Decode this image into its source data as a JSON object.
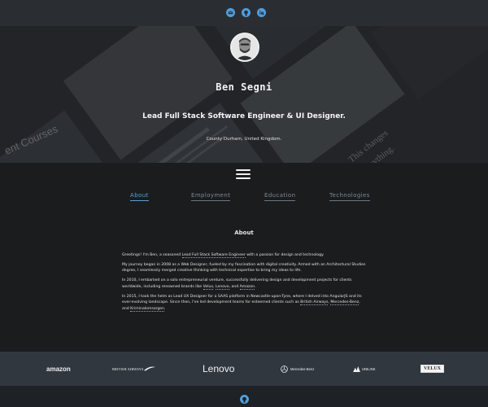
{
  "topbar": {
    "icons": [
      "email-icon",
      "github-icon",
      "linkedin-icon"
    ],
    "accent": "#4f9fe0"
  },
  "hero": {
    "name": "Ben Segni",
    "role": "Lead Full Stack Software Engineer & UI Designer.",
    "location": "County Durham, United Kingdom.",
    "background_text": [
      "ent Courses",
      "This changes",
      "everything."
    ]
  },
  "menu": {
    "icon": "hamburger-menu-icon"
  },
  "tabs": [
    {
      "label": "About",
      "active": true
    },
    {
      "label": "Employment",
      "active": false
    },
    {
      "label": "Education",
      "active": false
    },
    {
      "label": "Technologies",
      "active": false
    }
  ],
  "about": {
    "title": "About",
    "p1": {
      "t1": "Greetings! I'm Ben, a seasoned ",
      "link": "Lead Full Stack Software Engineer",
      "t2": " with a passion for design and technology."
    },
    "p2": "My journey began in 2008 as a Web Designer, fueled by my fascination with digital creativity. Armed with an Architectural Studies degree, I seamlessly merged creative thinking with technical expertise to bring my ideas to life.",
    "p3": {
      "t1": "In 2010, I embarked on a solo entrepreneurial venture, successfully delivering design and development projects for clients worldwide, including renowned brands like ",
      "l1": "Velux",
      "s1": ", ",
      "l2": "Lenovo",
      "s2": ", and ",
      "l3": "Amazon",
      "s3": "."
    },
    "p4": {
      "t1": "In 2015, I took the helm as Lead UX Designer for a SAAS platform in Newcastle-upon-Tyne, where I delved into AngularJS and its ever-evolving landscape. Since then, I've led development teams for esteemed clients such as ",
      "l1": "British Airways",
      "s1": ", ",
      "l2": "Mercedes-Benz",
      "s2": ", and ",
      "l3": "Kriminalomsorgen",
      "s3": "."
    }
  },
  "clients": {
    "amazon": "amazon",
    "british_airways": "BRITISH AIRWAYS",
    "lenovo": "Lenovo",
    "mercedes": "Mercedes-Benz",
    "unilink": "UNILINK",
    "velux": "VELUX"
  },
  "footer": {
    "icon": "github-icon"
  }
}
